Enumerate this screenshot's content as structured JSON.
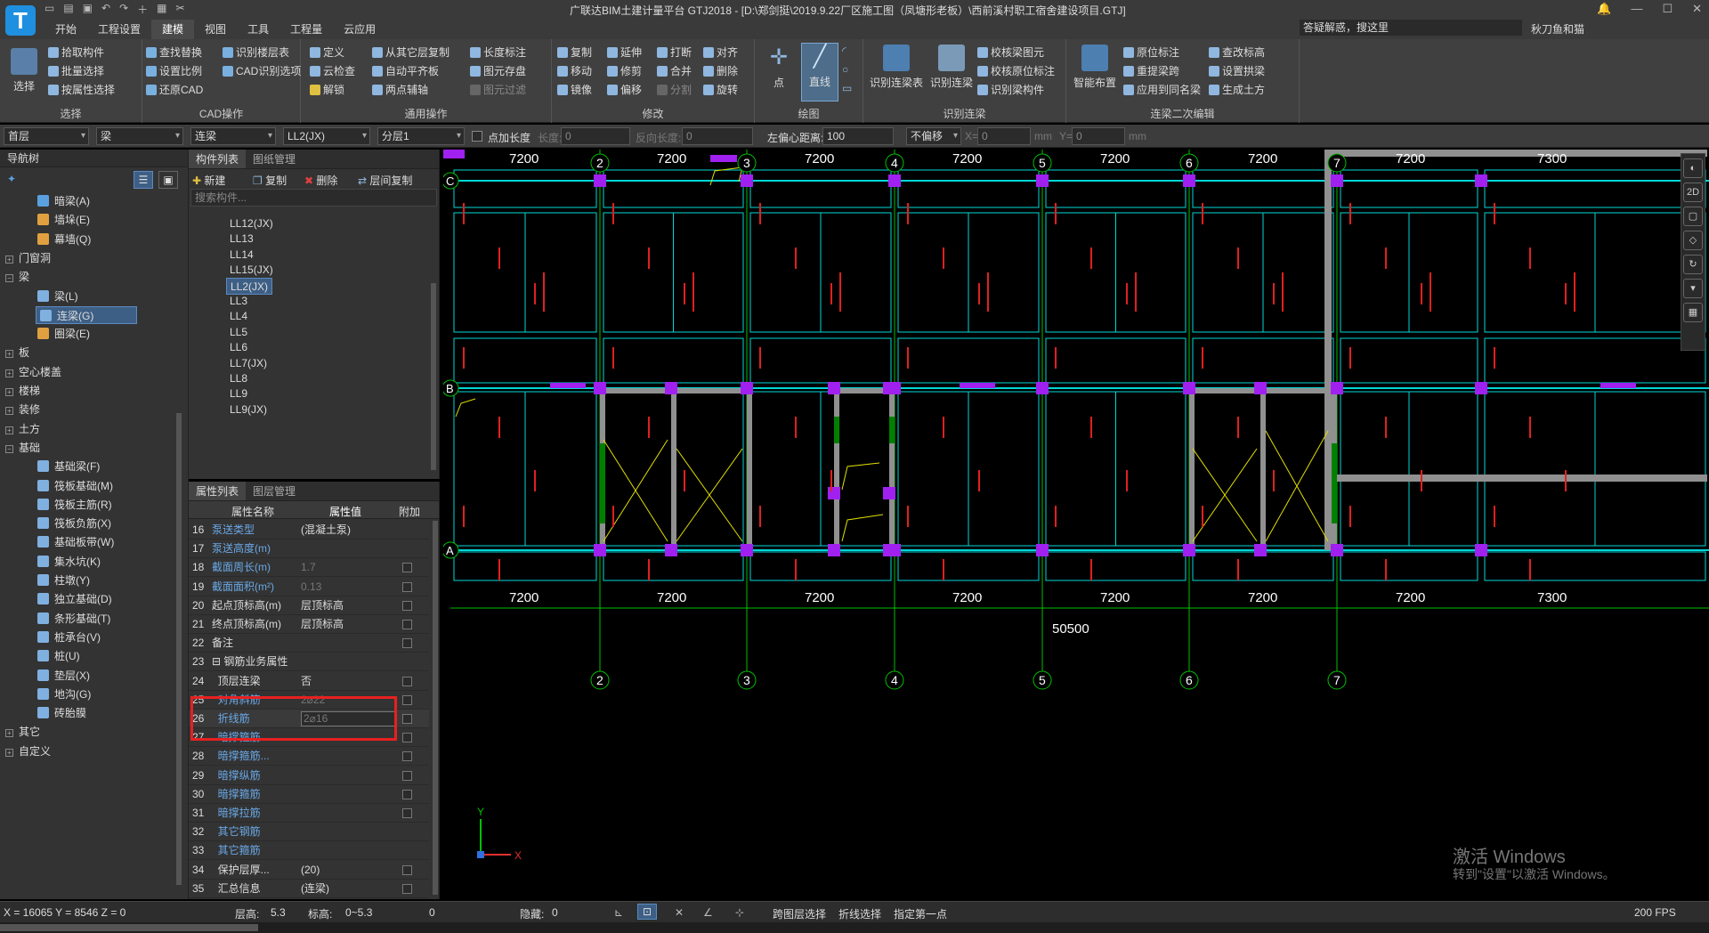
{
  "app": {
    "title": "广联达BIM土建计量平台 GTJ2018 - [D:\\郑剑挺\\2019.9.22厂区施工图（凤塘形老板）\\西前溪村职工宿舍建设项目.GTJ]",
    "logo_letter": "T",
    "help_placeholder": "答疑解惑，搜这里",
    "user": "秋刀鱼和猫"
  },
  "menu_tabs": [
    "开始",
    "工程设置",
    "建模",
    "视图",
    "工具",
    "工程量",
    "云应用"
  ],
  "active_menu_tab": "建模",
  "ribbon": {
    "select_group": {
      "label": "选择",
      "big_button": "选择",
      "items": [
        "拾取构件",
        "批量选择",
        "按属性选择"
      ]
    },
    "cad_group": {
      "label": "CAD操作",
      "items": [
        "查找替换",
        "识别楼层表",
        "设置比例",
        "CAD识别选项",
        "还原CAD"
      ]
    },
    "common_group": {
      "label": "通用操作",
      "items": [
        "定义",
        "从其它层复制",
        "长度标注",
        "云检查",
        "自动平齐板",
        "图元存盘",
        "解锁",
        "两点辅轴",
        "图元过滤"
      ]
    },
    "modify_group": {
      "label": "修改",
      "items": [
        "复制",
        "延伸",
        "打断",
        "对齐",
        "移动",
        "修剪",
        "合并",
        "删除",
        "镜像",
        "偏移",
        "分割",
        "旋转"
      ]
    },
    "draw_group": {
      "label": "绘图",
      "big_buttons": [
        "点",
        "直线"
      ]
    },
    "recognize_group": {
      "label": "识别连梁",
      "big_buttons": [
        "识别连梁表",
        "识别连梁"
      ],
      "items": [
        "校核梁图元",
        "校核原位标注",
        "识别梁构件"
      ]
    },
    "edit_group": {
      "label": "连梁二次编辑",
      "big_buttons": [
        "智能布置"
      ],
      "items": [
        "原位标注",
        "查改标高",
        "重提梁跨",
        "设置拱梁",
        "应用到同名梁",
        "生成土方"
      ]
    }
  },
  "prop_toolbar": {
    "floor": "首层",
    "category": "梁",
    "type": "连梁",
    "component": "LL2(JX)",
    "layer": "分层1",
    "point_length_label": "点加长度",
    "length_label": "长度:",
    "length_value": "0",
    "reverse_label": "反向长度:",
    "reverse_value": "0",
    "offset_label": "左偏心距离:",
    "offset_value": "100",
    "no_offset": "不偏移",
    "x_label": "X=",
    "x_value": "0",
    "mm1": "mm",
    "y_label": "Y=",
    "y_value": "0",
    "mm2": "mm"
  },
  "nav": {
    "header": "导航树",
    "rows": [
      {
        "label": "暗梁(A)",
        "level": 2,
        "color": "#5aa0e0"
      },
      {
        "label": "墙垛(E)",
        "level": 2,
        "color": "#e0a040"
      },
      {
        "label": "幕墙(Q)",
        "level": 2,
        "color": "#e0a040"
      },
      {
        "label": "门窗洞",
        "level": 1,
        "expand": "+"
      },
      {
        "label": "梁",
        "level": 1,
        "expand": "−"
      },
      {
        "label": "梁(L)",
        "level": 2,
        "color": "#7fb0e0"
      },
      {
        "label": "连梁(G)",
        "level": 2,
        "color": "#7fb0e0",
        "selected": true
      },
      {
        "label": "圈梁(E)",
        "level": 2,
        "color": "#e0a040"
      },
      {
        "label": "板",
        "level": 1,
        "expand": "+"
      },
      {
        "label": "空心楼盖",
        "level": 1,
        "expand": "+"
      },
      {
        "label": "楼梯",
        "level": 1,
        "expand": "+"
      },
      {
        "label": "装修",
        "level": 1,
        "expand": "+"
      },
      {
        "label": "土方",
        "level": 1,
        "expand": "+"
      },
      {
        "label": "基础",
        "level": 1,
        "expand": "−"
      },
      {
        "label": "基础梁(F)",
        "level": 2,
        "color": "#7fb0e0"
      },
      {
        "label": "筏板基础(M)",
        "level": 2,
        "color": "#7fb0e0"
      },
      {
        "label": "筏板主筋(R)",
        "level": 2,
        "color": "#7fb0e0"
      },
      {
        "label": "筏板负筋(X)",
        "level": 2,
        "color": "#7fb0e0"
      },
      {
        "label": "基础板带(W)",
        "level": 2,
        "color": "#7fb0e0"
      },
      {
        "label": "集水坑(K)",
        "level": 2,
        "color": "#7fb0e0"
      },
      {
        "label": "柱墩(Y)",
        "level": 2,
        "color": "#7fb0e0"
      },
      {
        "label": "独立基础(D)",
        "level": 2,
        "color": "#7fb0e0"
      },
      {
        "label": "条形基础(T)",
        "level": 2,
        "color": "#7fb0e0"
      },
      {
        "label": "桩承台(V)",
        "level": 2,
        "color": "#7fb0e0"
      },
      {
        "label": "桩(U)",
        "level": 2,
        "color": "#7fb0e0"
      },
      {
        "label": "垫层(X)",
        "level": 2,
        "color": "#7fb0e0"
      },
      {
        "label": "地沟(G)",
        "level": 2,
        "color": "#7fb0e0"
      },
      {
        "label": "砖胎膜",
        "level": 2,
        "color": "#7fb0e0"
      },
      {
        "label": "其它",
        "level": 1,
        "expand": "+"
      },
      {
        "label": "自定义",
        "level": 1,
        "expand": "+"
      }
    ]
  },
  "component_panel": {
    "tabs": [
      "构件列表",
      "图纸管理"
    ],
    "tools": [
      "新建",
      "复制",
      "删除",
      "层间复制"
    ],
    "search_placeholder": "搜索构件...",
    "items": [
      "LL12(JX)",
      "LL13",
      "LL14",
      "LL15(JX)",
      "LL2(JX)",
      "LL3",
      "LL4",
      "LL5",
      "LL6",
      "LL7(JX)",
      "LL8",
      "LL9",
      "LL9(JX)"
    ],
    "selected": "LL2(JX)"
  },
  "attr_panel": {
    "tabs": [
      "属性列表",
      "图层管理"
    ],
    "headers": [
      "属性名称",
      "属性值",
      "附加"
    ],
    "rows": [
      {
        "no": "16",
        "name": "泵送类型",
        "value": "(混凝土泵)",
        "style": "blue",
        "check": false
      },
      {
        "no": "17",
        "name": "泵送高度(m)",
        "value": "",
        "style": "blue",
        "check": false
      },
      {
        "no": "18",
        "name": "截面周长(m)",
        "value": "1.7",
        "style": "blue",
        "dim": true,
        "check": true
      },
      {
        "no": "19",
        "name": "截面面积(m²)",
        "value": "0.13",
        "style": "blue",
        "dim": true,
        "check": true
      },
      {
        "no": "20",
        "name": "起点顶标高(m)",
        "value": "层顶标高",
        "style": "white",
        "check": true
      },
      {
        "no": "21",
        "name": "终点顶标高(m)",
        "value": "层顶标高",
        "style": "white",
        "check": true
      },
      {
        "no": "22",
        "name": "备注",
        "value": "",
        "style": "white",
        "check": true
      },
      {
        "no": "23",
        "name": "⊟ 钢筋业务属性",
        "value": "",
        "style": "white",
        "check": false
      },
      {
        "no": "24",
        "name": "  顶层连梁",
        "value": "否",
        "style": "white",
        "check": true
      },
      {
        "no": "25",
        "name": "  对角斜筋",
        "value": "2⌀22",
        "style": "blue",
        "dim": true,
        "check": true
      },
      {
        "no": "26",
        "name": "  折线筋",
        "value": "2⌀16",
        "style": "blue",
        "dim": true,
        "check": true
      },
      {
        "no": "27",
        "name": "  暗撑箍筋...",
        "value": "",
        "style": "blue",
        "check": true
      },
      {
        "no": "28",
        "name": "  暗撑箍筋...",
        "value": "",
        "style": "blue",
        "check": true
      },
      {
        "no": "29",
        "name": "  暗撑纵筋",
        "value": "",
        "style": "blue",
        "check": true
      },
      {
        "no": "30",
        "name": "  暗撑箍筋",
        "value": "",
        "style": "blue",
        "check": true
      },
      {
        "no": "31",
        "name": "  暗撑拉筋",
        "value": "",
        "style": "blue",
        "check": true
      },
      {
        "no": "32",
        "name": "  其它钢筋",
        "value": "",
        "style": "blue",
        "check": false
      },
      {
        "no": "33",
        "name": "  其它箍筋",
        "value": "",
        "style": "blue",
        "check": false
      },
      {
        "no": "34",
        "name": "  保护层厚...",
        "value": "(20)",
        "style": "white",
        "check": true
      },
      {
        "no": "35",
        "name": "  汇总信息",
        "value": "(连梁)",
        "style": "white",
        "check": true
      }
    ]
  },
  "drawing": {
    "top_dims": [
      "7200",
      "7200",
      "7200",
      "7200",
      "7200",
      "7200",
      "7200",
      "7300"
    ],
    "bottom_dims": [
      "7200",
      "7200",
      "7200",
      "7200",
      "7200",
      "7200",
      "7200",
      "7300"
    ],
    "total_dim": "50500",
    "axis_numbers": [
      "2",
      "3",
      "4",
      "5",
      "6",
      "7"
    ],
    "axis_letters": [
      "C",
      "B",
      "A"
    ],
    "ucs_x": "X",
    "ucs_y": "Y"
  },
  "watermark": {
    "line1": "激活 Windows",
    "line2": "转到\"设置\"以激活 Windows。"
  },
  "status": {
    "coords": "X = 16065 Y = 8546 Z = 0",
    "floor_height_label": "层高:",
    "floor_height": "5.3",
    "elev_label": "标高:",
    "elev": "0~5.3",
    "zero": "0",
    "hidden_label": "隐藏:",
    "hidden": "0",
    "cross_layer": "跨图层选择",
    "fold_select": "折线选择",
    "specify_first": "指定第一点",
    "fps": "200 FPS"
  },
  "colors": {
    "grid_cyan": "#00d8d8",
    "column_purple": "#a020f0",
    "beam_gray": "#909090",
    "axis_green": "#00c000",
    "diag_yellow": "#e0e000",
    "annot_red": "#e02020",
    "highlight_red": "#e82020"
  }
}
